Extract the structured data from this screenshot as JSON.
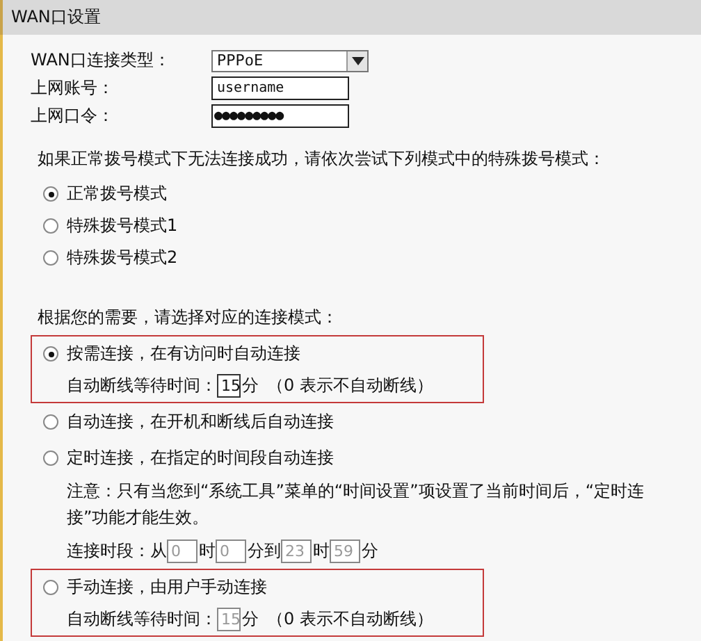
{
  "window": {
    "title": "WAN口设置"
  },
  "fields": [
    {
      "kind": "select",
      "label": "WAN口连接类型：",
      "value": "PPPoE"
    },
    {
      "kind": "text",
      "label": "上网账号：",
      "value": "username"
    },
    {
      "kind": "password",
      "label": "上网口令：",
      "value": "●●●●●●●●●"
    }
  ],
  "dial_prompt": "如果正常拨号模式下无法连接成功，请依次尝试下列模式中的特殊拨号模式：",
  "dial_modes": [
    {
      "label": "正常拨号模式",
      "selected": true
    },
    {
      "label": "特殊拨号模式1",
      "selected": false
    },
    {
      "label": "特殊拨号模式2",
      "selected": false
    }
  ],
  "connect_prompt": "根据您的需要，请选择对应的连接模式：",
  "connect_modes": [
    {
      "label": "按需连接，在有访问时自动连接",
      "selected": true,
      "highlighted": true,
      "details": [
        {
          "kind": "wait",
          "label": "自动断线等待时间：",
          "value": "15",
          "unit": "分",
          "hint": "（0 表示不自动断线）",
          "disabled": false
        }
      ]
    },
    {
      "label": "自动连接，在开机和断线后自动连接",
      "selected": false,
      "highlighted": false
    },
    {
      "label": "定时连接，在指定的时间段自动连接",
      "selected": false,
      "highlighted": false,
      "details": [
        {
          "kind": "note",
          "text": "注意：只有当您到“系统工具”菜单的“时间设置”项设置了当前时间后，“定时连接”功能才能生效。"
        },
        {
          "kind": "period",
          "label": "连接时段：从",
          "disabled": true,
          "inputs": [
            {
              "value": "0",
              "unit": "时"
            },
            {
              "value": "0",
              "unit": "分到"
            },
            {
              "value": "23",
              "unit": "时"
            },
            {
              "value": "59",
              "unit": "分"
            }
          ]
        }
      ]
    },
    {
      "label": "手动连接，由用户手动连接",
      "selected": false,
      "highlighted": true,
      "details": [
        {
          "kind": "wait",
          "label": "自动断线等待时间：",
          "value": "15",
          "unit": "分",
          "hint": "（0 表示不自动断线）",
          "disabled": true
        }
      ]
    }
  ]
}
